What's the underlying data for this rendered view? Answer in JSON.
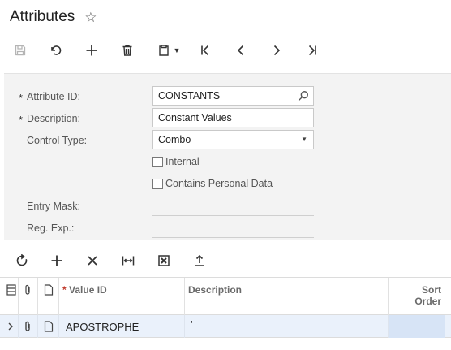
{
  "header": {
    "title": "Attributes",
    "favorite_icon": "star-outline-icon"
  },
  "toolbar": [
    {
      "name": "save-button",
      "icon": "save-icon",
      "disabled": true
    },
    {
      "name": "undo-button",
      "icon": "undo-icon"
    },
    {
      "name": "add-button",
      "icon": "plus-icon"
    },
    {
      "name": "delete-button",
      "icon": "trash-icon"
    },
    {
      "name": "copy-paste-button",
      "icon": "clipboard-icon"
    },
    {
      "name": "first-record-button",
      "icon": "first-icon"
    },
    {
      "name": "previous-record-button",
      "icon": "chevron-left-icon"
    },
    {
      "name": "next-record-button",
      "icon": "chevron-right-icon"
    },
    {
      "name": "last-record-button",
      "icon": "last-icon"
    }
  ],
  "form": {
    "attribute_id": {
      "label": "Attribute ID:",
      "value": "CONSTANTS",
      "required_mark": "*"
    },
    "description": {
      "label": "Description:",
      "value": "Constant Values",
      "required_mark": "*"
    },
    "control_type": {
      "label": "Control Type:",
      "value": "Combo"
    },
    "internal": {
      "label": "Internal",
      "checked": false
    },
    "contains_personal_data": {
      "label": "Contains Personal Data",
      "checked": false
    },
    "entry_mask": {
      "label": "Entry Mask:",
      "value": ""
    },
    "reg_exp": {
      "label": "Reg. Exp.:",
      "value": ""
    }
  },
  "grid_toolbar": [
    {
      "name": "refresh-button",
      "icon": "refresh-icon"
    },
    {
      "name": "grid-add-button",
      "icon": "plus-icon"
    },
    {
      "name": "grid-delete-button",
      "icon": "close-icon"
    },
    {
      "name": "fit-columns-button",
      "icon": "fit-width-icon"
    },
    {
      "name": "export-excel-button",
      "icon": "excel-icon"
    },
    {
      "name": "upload-button",
      "icon": "upload-icon"
    }
  ],
  "grid": {
    "columns": {
      "value_id": {
        "label": "Value ID",
        "required_mark": "*"
      },
      "description": "Description",
      "sort_order_line1": "Sort",
      "sort_order_line2": "Order"
    },
    "rows": [
      {
        "value_id": "APOSTROPHE",
        "description": "'",
        "sort_order": ""
      }
    ]
  }
}
